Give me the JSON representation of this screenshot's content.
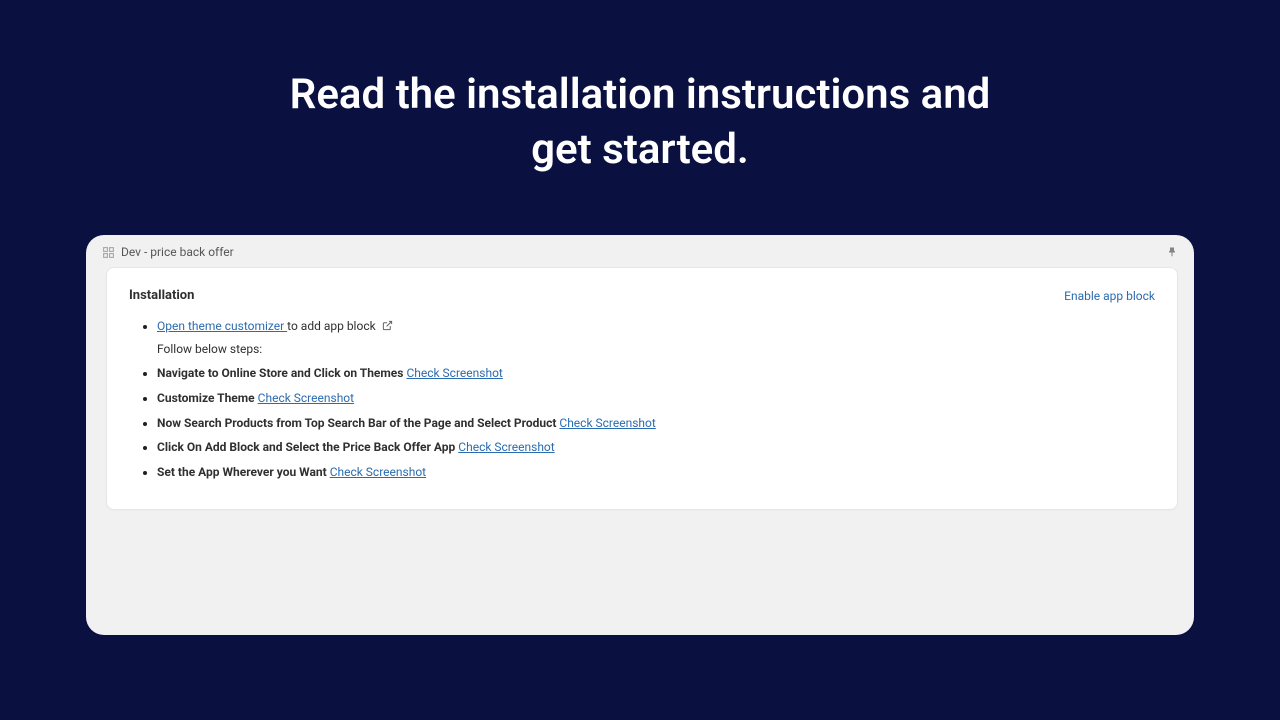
{
  "headline": "Read the installation instructions and get started.",
  "window": {
    "title": "Dev - price back offer"
  },
  "card": {
    "title": "Installation",
    "enable_link": "Enable app block"
  },
  "steps": {
    "open_customizer_link": "Open theme customizer ",
    "open_customizer_suffix": "to add app block",
    "follow_steps": "Follow below steps:",
    "step1_text": "Navigate to Online Store and Click on Themes",
    "step1_link": "Check Screenshot",
    "step2_text": "Customize Theme",
    "step2_link": "Check Screenshot",
    "step3_text": "Now Search Products from Top Search Bar of the Page and Select Product",
    "step3_link": "Check Screenshot",
    "step4_text": "Click On Add Block and Select the Price Back Offer App",
    "step4_link": "Check Screenshot",
    "step5_text": "Set the App Wherever you Want",
    "step5_link": "Check Screenshot"
  }
}
